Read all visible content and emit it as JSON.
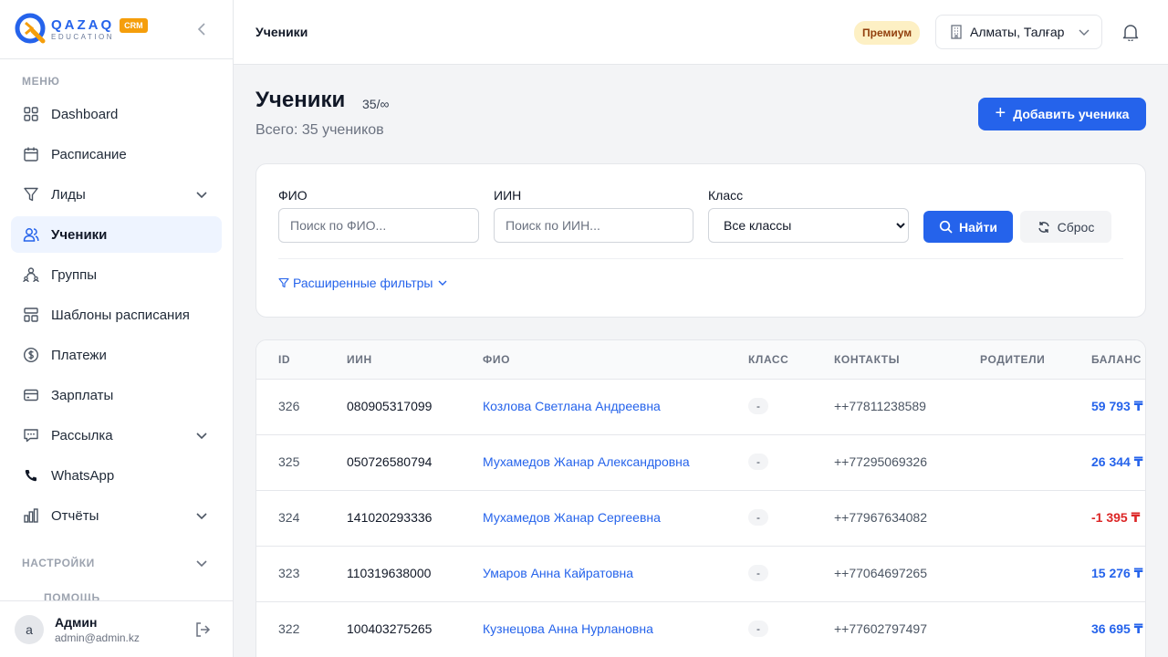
{
  "brand": {
    "name": "QAZAQ",
    "sub": "EDUCATION",
    "badge": "CRM",
    "accent": "#2563eb",
    "badge_color": "#f59e0b"
  },
  "sidebar": {
    "menu_label": "МЕНЮ",
    "items": [
      {
        "label": "Dashboard",
        "icon": "grid-icon",
        "has_chevron": false
      },
      {
        "label": "Расписание",
        "icon": "calendar-icon",
        "has_chevron": false
      },
      {
        "label": "Лиды",
        "icon": "funnel-icon",
        "has_chevron": true
      },
      {
        "label": "Ученики",
        "icon": "users-icon",
        "has_chevron": false,
        "active": true
      },
      {
        "label": "Группы",
        "icon": "group-icon",
        "has_chevron": false
      },
      {
        "label": "Шаблоны расписания",
        "icon": "template-icon",
        "has_chevron": false
      },
      {
        "label": "Платежи",
        "icon": "dollar-icon",
        "has_chevron": false
      },
      {
        "label": "Зарплаты",
        "icon": "card-icon",
        "has_chevron": false
      },
      {
        "label": "Рассылка",
        "icon": "chat-icon",
        "has_chevron": true
      },
      {
        "label": "WhatsApp",
        "icon": "phone-icon",
        "has_chevron": false
      },
      {
        "label": "Отчёты",
        "icon": "chart-icon",
        "has_chevron": true
      }
    ],
    "settings_label": "НАСТРОЙКИ",
    "help_label": "ПОМОЩЬ",
    "user": {
      "initial": "a",
      "name": "Админ",
      "email": "admin@admin.kz"
    }
  },
  "header": {
    "title": "Ученики",
    "premium": "Премиум",
    "branch": "Алматы, Талғар"
  },
  "page": {
    "title": "Ученики",
    "count": "35/∞",
    "subtitle": "Всего: 35 учеников",
    "add_button": "Добавить ученика"
  },
  "filters": {
    "fio_label": "ФИО",
    "fio_placeholder": "Поиск по ФИО...",
    "iin_label": "ИИН",
    "iin_placeholder": "Поиск по ИИН...",
    "class_label": "Класс",
    "class_value": "Все классы",
    "find_button": "Найти",
    "reset_button": "Сброс",
    "advanced": "Расширенные фильтры"
  },
  "table": {
    "headers": [
      "ID",
      "ИИН",
      "ФИО",
      "КЛАСС",
      "КОНТАКТЫ",
      "РОДИТЕЛИ",
      "БАЛАНС"
    ],
    "rows": [
      {
        "id": "326",
        "iin": "080905317099",
        "name": "Козлова Светлана Андреевна",
        "class": "-",
        "contact": "++77811238589",
        "parents": "",
        "balance": "59 793 ₸",
        "negative": false
      },
      {
        "id": "325",
        "iin": "050726580794",
        "name": "Мухамедов Жанар Александровна",
        "class": "-",
        "contact": "++77295069326",
        "parents": "",
        "balance": "26 344 ₸",
        "negative": false
      },
      {
        "id": "324",
        "iin": "141020293336",
        "name": "Мухамедов Жанар Сергеевна",
        "class": "-",
        "contact": "++77967634082",
        "parents": "",
        "balance": "-1 395 ₸",
        "negative": true
      },
      {
        "id": "323",
        "iin": "110319638000",
        "name": "Умаров Анна Кайратовна",
        "class": "-",
        "contact": "++77064697265",
        "parents": "",
        "balance": "15 276 ₸",
        "negative": false
      },
      {
        "id": "322",
        "iin": "100403275265",
        "name": "Кузнецова Анна Нурлановна",
        "class": "-",
        "contact": "++77602797497",
        "parents": "",
        "balance": "36 695 ₸",
        "negative": false
      }
    ],
    "positive_color": "#2563eb",
    "negative_color": "#dc2626"
  }
}
